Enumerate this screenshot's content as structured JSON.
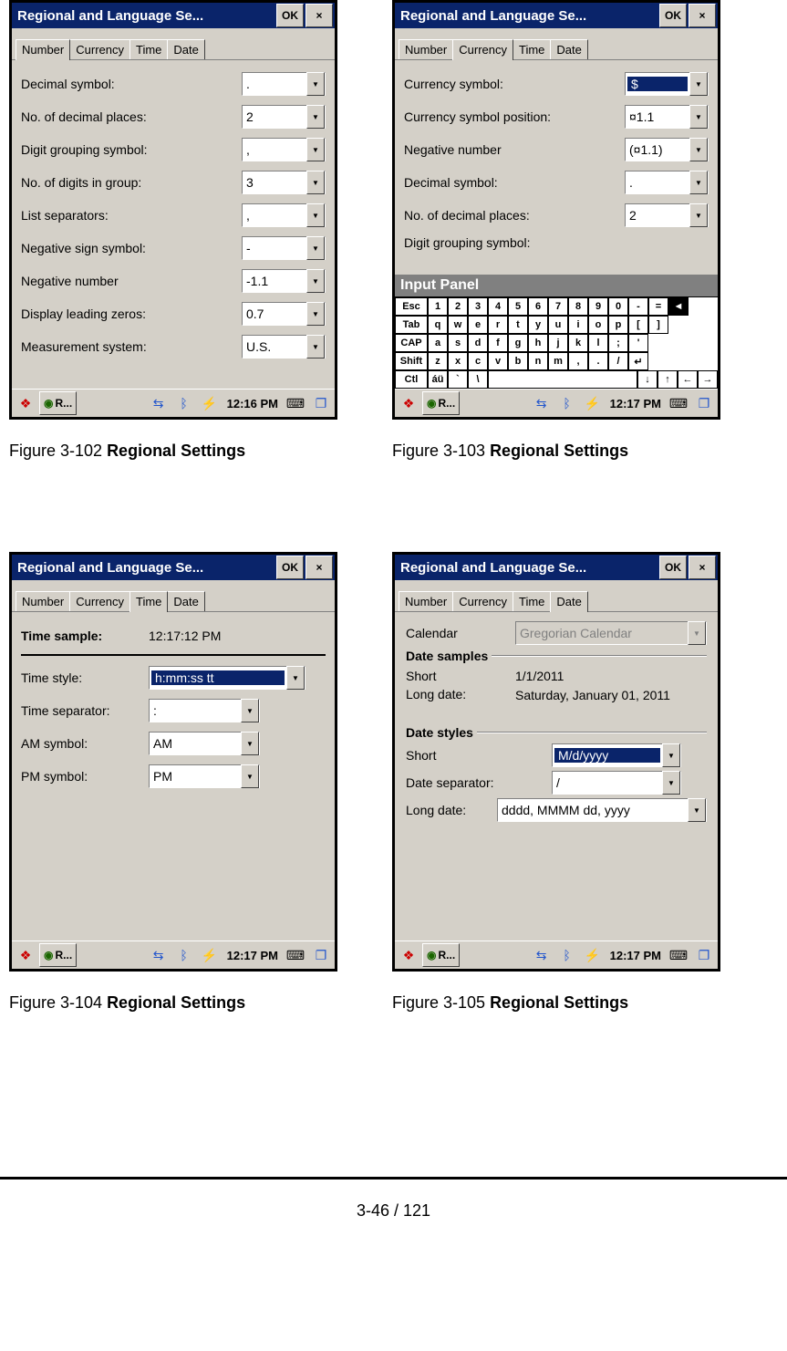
{
  "common": {
    "window_title": "Regional and Language Se...",
    "ok_label": "OK",
    "close_label": "×",
    "tabs": {
      "number": "Number",
      "currency": "Currency",
      "time": "Time",
      "date": "Date"
    },
    "taskbar_task": "R..."
  },
  "screens": {
    "s102": {
      "active_tab": "Number",
      "rows": [
        {
          "label": "Decimal symbol:",
          "value": "."
        },
        {
          "label": "No. of decimal places:",
          "value": "2"
        },
        {
          "label": "Digit grouping symbol:",
          "value": ","
        },
        {
          "label": "No. of digits in group:",
          "value": "3"
        },
        {
          "label": "List separators:",
          "value": ","
        },
        {
          "label": "Negative sign symbol:",
          "value": "-"
        },
        {
          "label": "Negative number",
          "value": "-1.1"
        },
        {
          "label": "Display leading zeros:",
          "value": "0.7"
        },
        {
          "label": "Measurement system:",
          "value": "U.S."
        }
      ],
      "taskbar_time": "12:16 PM"
    },
    "s103": {
      "active_tab": "Currency",
      "rows": [
        {
          "label": "Currency symbol:",
          "value": "$",
          "selected": true
        },
        {
          "label": "Currency symbol position:",
          "value": "¤1.1"
        },
        {
          "label": "Negative number",
          "value": "(¤1.1)"
        },
        {
          "label": "Decimal symbol:",
          "value": "."
        },
        {
          "label": "No. of decimal places:",
          "value": "2"
        }
      ],
      "cut_label": "Digit grouping symbol:",
      "input_panel_title": "Input Panel",
      "kbd": {
        "r1": [
          "Esc",
          "1",
          "2",
          "3",
          "4",
          "5",
          "6",
          "7",
          "8",
          "9",
          "0",
          "-",
          "=",
          "◄"
        ],
        "r2": [
          "Tab",
          "q",
          "w",
          "e",
          "r",
          "t",
          "y",
          "u",
          "i",
          "o",
          "p",
          "[",
          "]"
        ],
        "r3": [
          "CAP",
          "a",
          "s",
          "d",
          "f",
          "g",
          "h",
          "j",
          "k",
          "l",
          ";",
          "'"
        ],
        "r4": [
          "Shift",
          "z",
          "x",
          "c",
          "v",
          "b",
          "n",
          "m",
          ",",
          ".",
          "/",
          "↵"
        ],
        "r5": [
          "Ctl",
          "áü",
          "`",
          "\\",
          " ",
          "↓",
          "↑",
          "←",
          "→"
        ]
      },
      "taskbar_time": "12:17 PM"
    },
    "s104": {
      "active_tab": "Time",
      "sample_label": "Time sample:",
      "sample_value": "12:17:12 PM",
      "rows": [
        {
          "label": "Time style:",
          "value": "h:mm:ss tt",
          "selected": true,
          "wide": true
        },
        {
          "label": "Time separator:",
          "value": ":"
        },
        {
          "label": "AM symbol:",
          "value": "AM"
        },
        {
          "label": "PM symbol:",
          "value": "PM"
        }
      ],
      "taskbar_time": "12:17 PM"
    },
    "s105": {
      "active_tab": "Date",
      "calendar_label": "Calendar",
      "calendar_value": "Gregorian Calendar",
      "samples_title": "Date samples",
      "samples": {
        "short_label": "Short",
        "short_value": "1/1/2011",
        "long_label": "Long date:",
        "long_value": "Saturday, January 01, 2011"
      },
      "styles_title": "Date styles",
      "short_style_label": "Short",
      "short_style_value": "M/d/yyyy",
      "sep_label": "Date separator:",
      "sep_value": "/",
      "long_style_label": "Long date:",
      "long_style_value": "dddd, MMMM dd, yyyy",
      "taskbar_time": "12:17 PM"
    }
  },
  "captions": {
    "c102": {
      "no": "Figure 3-102 ",
      "title": "Regional Settings"
    },
    "c103": {
      "no": "Figure 3-103 ",
      "title": "Regional Settings"
    },
    "c104": {
      "no": "Figure 3-104 ",
      "title": "Regional Settings"
    },
    "c105": {
      "no": "Figure 3-105 ",
      "title": "Regional Settings"
    }
  },
  "page_footer": "3-46 / 121"
}
